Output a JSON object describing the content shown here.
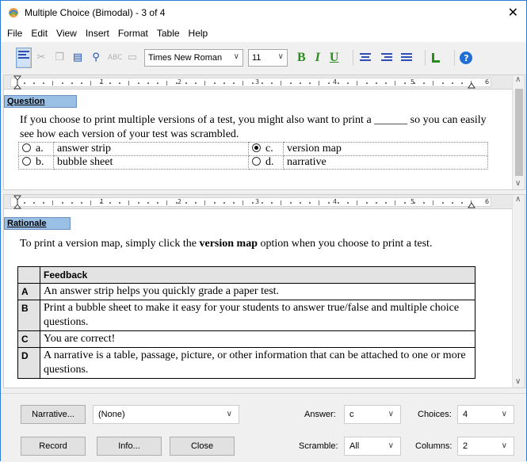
{
  "window": {
    "title": "Multiple Choice (Bimodal) - 3 of 4",
    "close_glyph": "✕"
  },
  "menu": [
    "File",
    "Edit",
    "View",
    "Insert",
    "Format",
    "Table",
    "Help"
  ],
  "toolbar": {
    "font_family": "Times New Roman",
    "font_size": "11",
    "bold": "B",
    "italic": "I",
    "underline": "U",
    "help": "?"
  },
  "ruler": {
    "numbers": [
      "1",
      "2",
      "3",
      "4",
      "5",
      "6"
    ]
  },
  "question_pane": {
    "label": "Question",
    "text": "If you choose to print multiple versions of a test, you might also want to print a ______ so you can easily see how each version of your test was scrambled.",
    "choices": [
      {
        "letter": "a.",
        "text": "answer strip",
        "selected": false
      },
      {
        "letter": "b.",
        "text": "bubble sheet",
        "selected": false
      },
      {
        "letter": "c.",
        "text": "version map",
        "selected": true
      },
      {
        "letter": "d.",
        "text": "narrative",
        "selected": false
      }
    ]
  },
  "rationale_pane": {
    "label": "Rationale",
    "text_before": "To print a version map, simply click the ",
    "text_bold": "version map",
    "text_after": " option when you choose to print a test.",
    "feedback_header": "Feedback",
    "feedback": [
      {
        "key": "A",
        "text": "An answer strip helps you quickly grade a paper test."
      },
      {
        "key": "B",
        "text": "Print a bubble sheet to make it easy for your students to answer true/false and multiple choice questions."
      },
      {
        "key": "C",
        "text": "You are correct!"
      },
      {
        "key": "D",
        "text": "A narrative is a table, passage, picture, or other information that can be attached to one or more questions."
      }
    ]
  },
  "bottom": {
    "narrative_button": "Narrative...",
    "narrative_select": "(None)",
    "answer_label": "Answer:",
    "answer_value": "c",
    "choices_label": "Choices:",
    "choices_value": "4",
    "record_button": "Record",
    "info_button": "Info...",
    "close_button": "Close",
    "scramble_label": "Scramble:",
    "scramble_value": "All",
    "columns_label": "Columns:",
    "columns_value": "2"
  },
  "colors": {
    "section_label_bg": "#9bc0e6",
    "window_border": "#2b7bd8",
    "format_green": "#2b8a1e",
    "align_blue": "#2f4fb2"
  }
}
